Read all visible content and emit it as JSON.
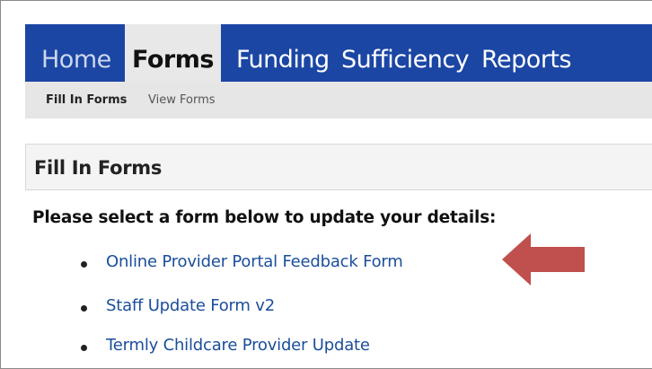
{
  "nav": {
    "tabs": [
      {
        "label": "Home"
      },
      {
        "label": "Forms",
        "active": true
      },
      {
        "label": "Funding"
      },
      {
        "label": "Sufficiency"
      },
      {
        "label": "Reports"
      }
    ],
    "subtabs": [
      {
        "label": "Fill In Forms",
        "active": true
      },
      {
        "label": "View Forms"
      }
    ]
  },
  "main": {
    "section_title": "Fill In Forms",
    "instructions": "Please select a form below to update your details:",
    "forms": [
      {
        "label": "Online Provider Portal Feedback Form"
      },
      {
        "label": "Staff Update Form v2"
      },
      {
        "label": "Termly Childcare Provider Update"
      }
    ]
  },
  "colors": {
    "nav_bg": "#1b46a4",
    "link": "#1b4e9b",
    "arrow": "#c0504d"
  },
  "icons": {
    "annotation": "left-arrow-icon"
  }
}
